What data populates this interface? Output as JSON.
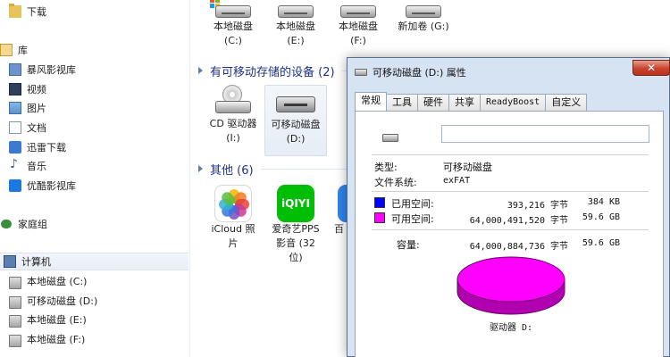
{
  "nav": {
    "items": [
      {
        "label": "下载",
        "icon": "download-folder-icon"
      },
      {
        "label": "库",
        "icon": "library-icon"
      },
      {
        "label": "暴风影视库",
        "icon": "baofeng-library-icon"
      },
      {
        "label": "视频",
        "icon": "video-library-icon"
      },
      {
        "label": "图片",
        "icon": "pictures-library-icon"
      },
      {
        "label": "文档",
        "icon": "documents-library-icon"
      },
      {
        "label": "迅雷下载",
        "icon": "xunlei-download-icon"
      },
      {
        "label": "音乐",
        "icon": "music-library-icon"
      },
      {
        "label": "优酷影视库",
        "icon": "youku-library-icon"
      },
      {
        "label": "家庭组",
        "icon": "homegroup-icon"
      },
      {
        "label": "计算机",
        "icon": "computer-icon"
      },
      {
        "label": "本地磁盘 (C:)",
        "icon": "drive-icon"
      },
      {
        "label": "可移动磁盘 (D:)",
        "icon": "removable-drive-icon"
      },
      {
        "label": "本地磁盘 (E:)",
        "icon": "drive-icon"
      },
      {
        "label": "本地磁盘 (F:)",
        "icon": "drive-icon"
      }
    ]
  },
  "content": {
    "hard_drives": [
      {
        "label": "本地磁盘\n(C:)"
      },
      {
        "label": "本地磁盘\n(E:)"
      },
      {
        "label": "本地磁盘\n(F:)"
      },
      {
        "label": "新加卷 (G:)"
      }
    ],
    "removable_group_title": "有可移动存储的设备 (2)",
    "removable": [
      {
        "label": "CD 驱动器\n(I:)"
      },
      {
        "label": "可移动磁盘\n(D:)"
      }
    ],
    "other_group_title": "其他 (6)",
    "other": [
      {
        "label": "iCloud 照\n片"
      },
      {
        "label": "爱奇艺PPS\n影音 (32\n位)"
      },
      {
        "label": "百"
      }
    ],
    "app_text": {
      "iqiyi": "iQIYI"
    }
  },
  "dialog": {
    "title": "可移动磁盘 (D:) 属性",
    "close": "✕",
    "tabs": [
      "常规",
      "工具",
      "硬件",
      "共享",
      "ReadyBoost",
      "自定义"
    ],
    "name_value": "",
    "type_label": "类型:",
    "type_value": "可移动磁盘",
    "fs_label": "文件系统:",
    "fs_value": "exFAT",
    "used_label": "已用空间:",
    "used_bytes": "393,216 字节",
    "used_size": "384 KB",
    "free_label": "可用空间:",
    "free_bytes": "64,000,491,520 字节",
    "free_size": "59.6 GB",
    "cap_label": "容量:",
    "cap_bytes": "64,000,884,736 字节",
    "cap_size": "59.6 GB",
    "drive_label": "驱动器 D:",
    "colors": {
      "used": "#0000ff",
      "free": "#ff00ff",
      "pie_side": "#b000b0"
    }
  }
}
